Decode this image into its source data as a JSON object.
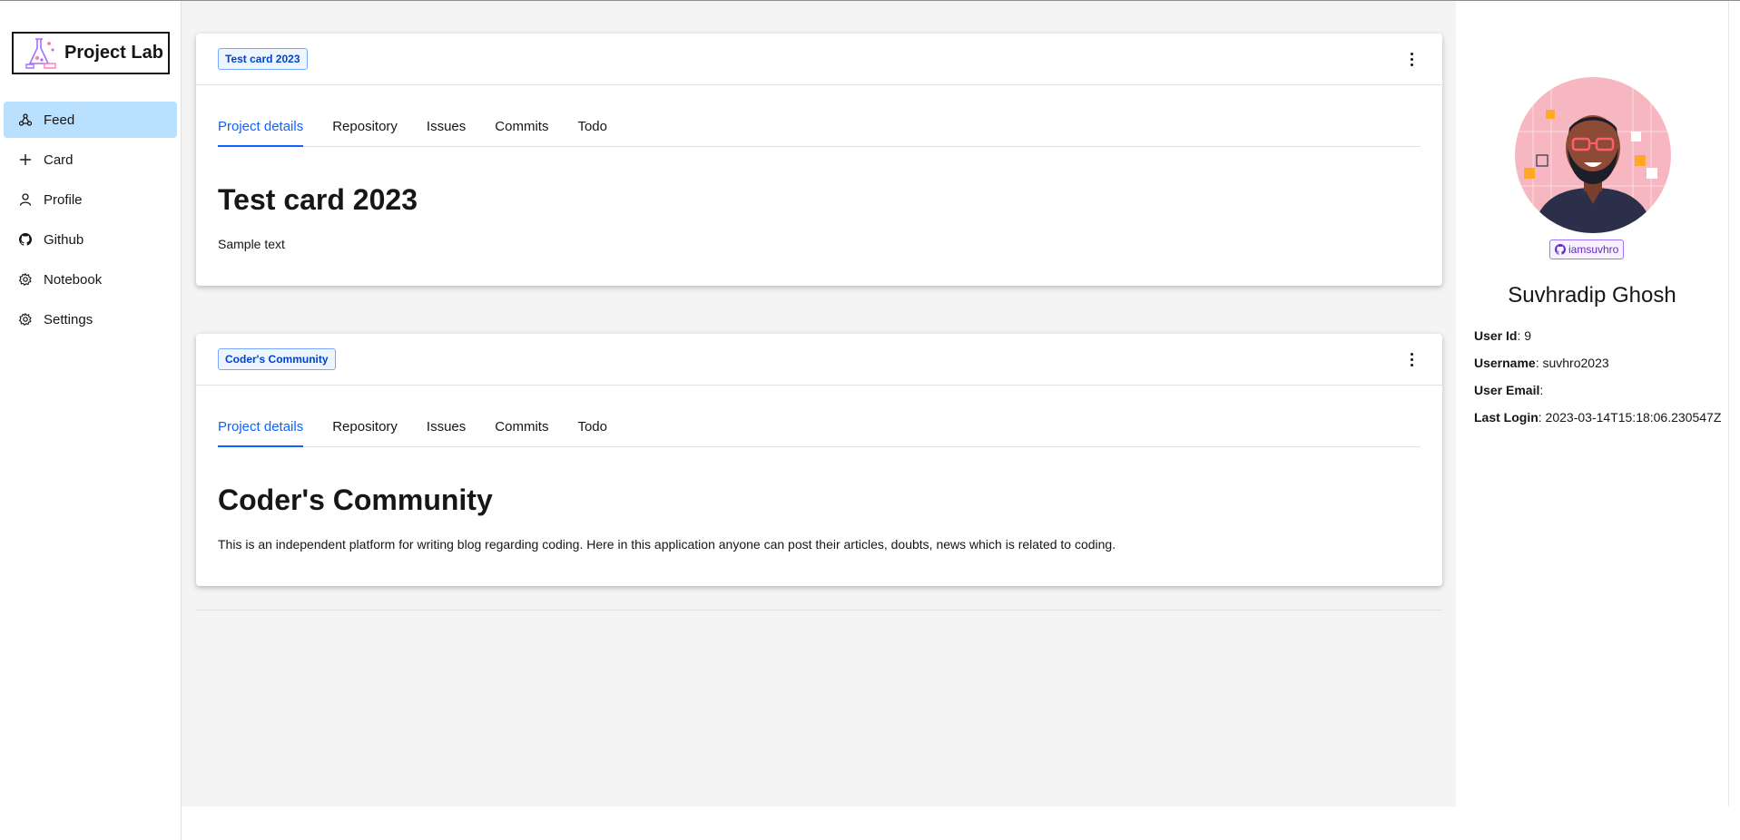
{
  "app": {
    "logo_text": "Project Lab"
  },
  "sidebar": {
    "items": [
      {
        "label": "Feed",
        "icon": "share-nodes-icon"
      },
      {
        "label": "Card",
        "icon": "plus-icon"
      },
      {
        "label": "Profile",
        "icon": "user-icon"
      },
      {
        "label": "Github",
        "icon": "github-icon"
      },
      {
        "label": "Notebook",
        "icon": "gear-icon"
      },
      {
        "label": "Settings",
        "icon": "gear-icon"
      }
    ],
    "active_index": 0
  },
  "cards": [
    {
      "tag": "Test card 2023",
      "tabs": [
        "Project details",
        "Repository",
        "Issues",
        "Commits",
        "Todo"
      ],
      "title": "Test card 2023",
      "text": "Sample text"
    },
    {
      "tag": "Coder's Community",
      "tabs": [
        "Project details",
        "Repository",
        "Issues",
        "Commits",
        "Todo"
      ],
      "title": "Coder's Community",
      "text": "This is an independent platform for writing blog regarding coding. Here in this application anyone can post their articles, doubts, news which is related to coding."
    }
  ],
  "profile": {
    "github_handle": "iamsuvhro",
    "name": "Suvhradip Ghosh",
    "user_id_label": "User Id",
    "user_id": ": 9",
    "username_label": "Username",
    "username": ": suvhro2023",
    "email_label": "User Email",
    "email": ":",
    "last_login_label": "Last Login",
    "last_login": ": 2023-03-14T15:18:06.230547Z"
  },
  "colors": {
    "accent": "#0f62fe",
    "active_nav": "#bae0ff",
    "tag_bg": "#edf5ff",
    "github_badge": "#6929c4",
    "avatar_bg": "#f7b7c0"
  }
}
